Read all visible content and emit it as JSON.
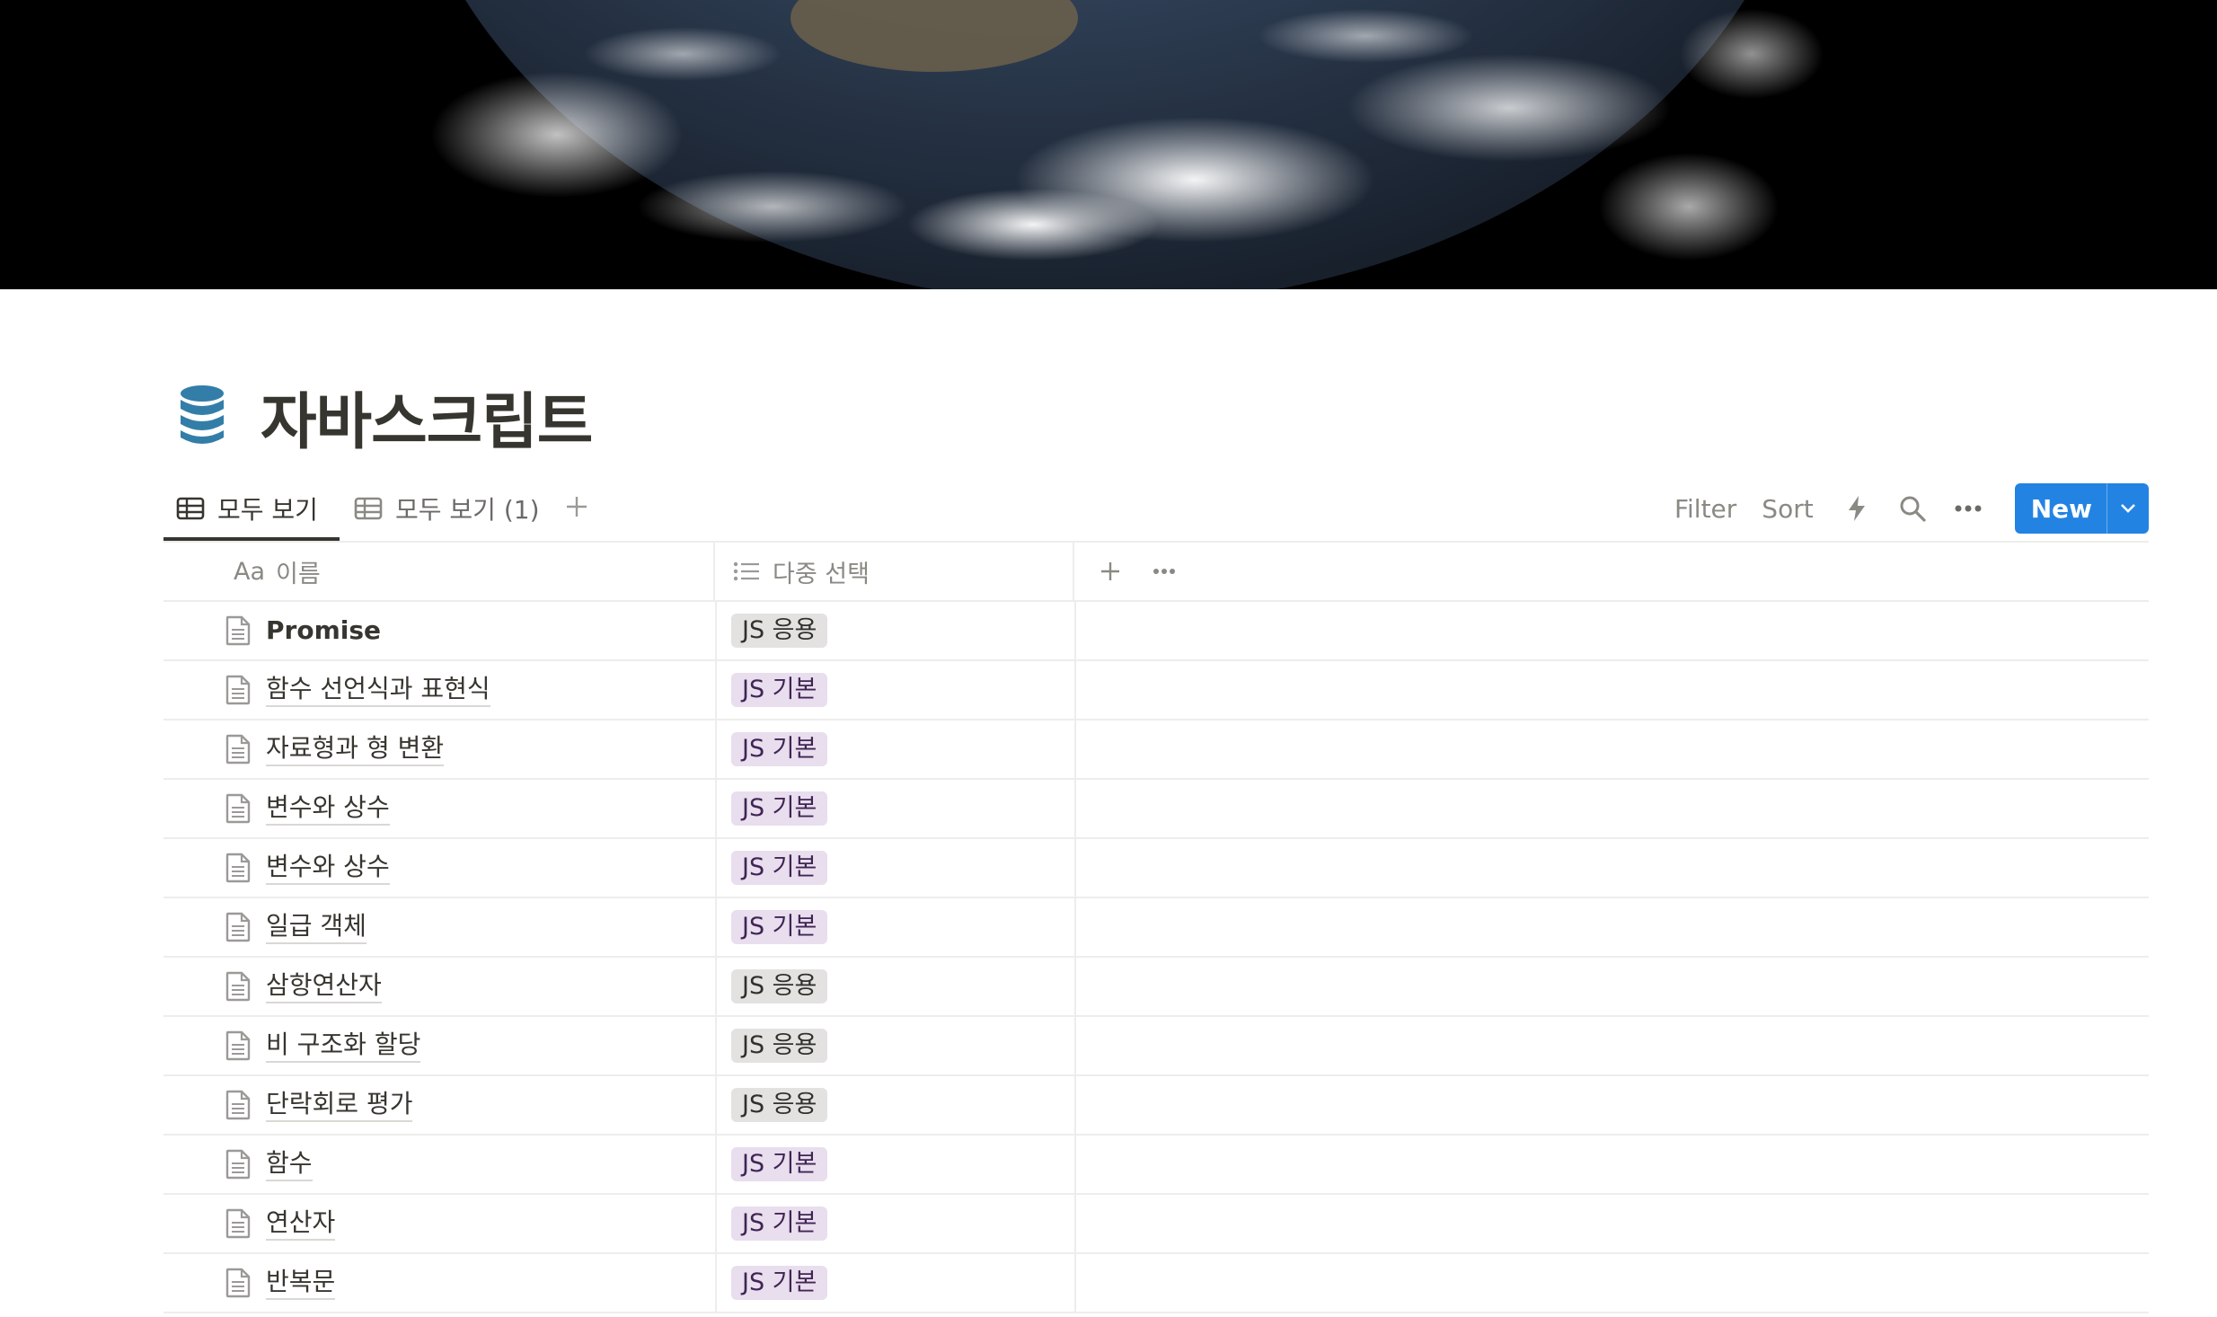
{
  "page": {
    "title": "자바스크립트",
    "icon": "database-icon"
  },
  "views": {
    "tabs": [
      {
        "label": "모두 보기",
        "icon": "table-icon",
        "active": true
      },
      {
        "label": "모두 보기 (1)",
        "icon": "table-icon",
        "active": false
      }
    ]
  },
  "toolbar": {
    "filter_label": "Filter",
    "sort_label": "Sort",
    "new_label": "New"
  },
  "table": {
    "columns": [
      {
        "prefix": "Aa",
        "label": "이름"
      },
      {
        "label": "다중 선택",
        "icon": "list-icon"
      }
    ],
    "rows": [
      {
        "name": "Promise",
        "tag": "JS 응용",
        "tag_type": "apply"
      },
      {
        "name": "함수 선언식과 표현식",
        "tag": "JS 기본",
        "tag_type": "basic"
      },
      {
        "name": "자료형과 형 변환",
        "tag": "JS 기본",
        "tag_type": "basic"
      },
      {
        "name": "변수와 상수",
        "tag": "JS 기본",
        "tag_type": "basic"
      },
      {
        "name": "변수와 상수",
        "tag": "JS 기본",
        "tag_type": "basic"
      },
      {
        "name": "일급 객체",
        "tag": "JS 기본",
        "tag_type": "basic"
      },
      {
        "name": "삼항연산자",
        "tag": "JS 응용",
        "tag_type": "apply"
      },
      {
        "name": "비 구조화 할당",
        "tag": "JS 응용",
        "tag_type": "apply"
      },
      {
        "name": "단락회로 평가",
        "tag": "JS 응용",
        "tag_type": "apply"
      },
      {
        "name": "함수",
        "tag": "JS 기본",
        "tag_type": "basic"
      },
      {
        "name": "연산자",
        "tag": "JS 기본",
        "tag_type": "basic"
      },
      {
        "name": "반복문",
        "tag": "JS 기본",
        "tag_type": "basic"
      }
    ]
  },
  "colors": {
    "accent": "#2383e2",
    "tag_apply_bg": "#e3e2e0",
    "tag_basic_bg": "#e8deee",
    "database_icon": "#337ea9"
  }
}
